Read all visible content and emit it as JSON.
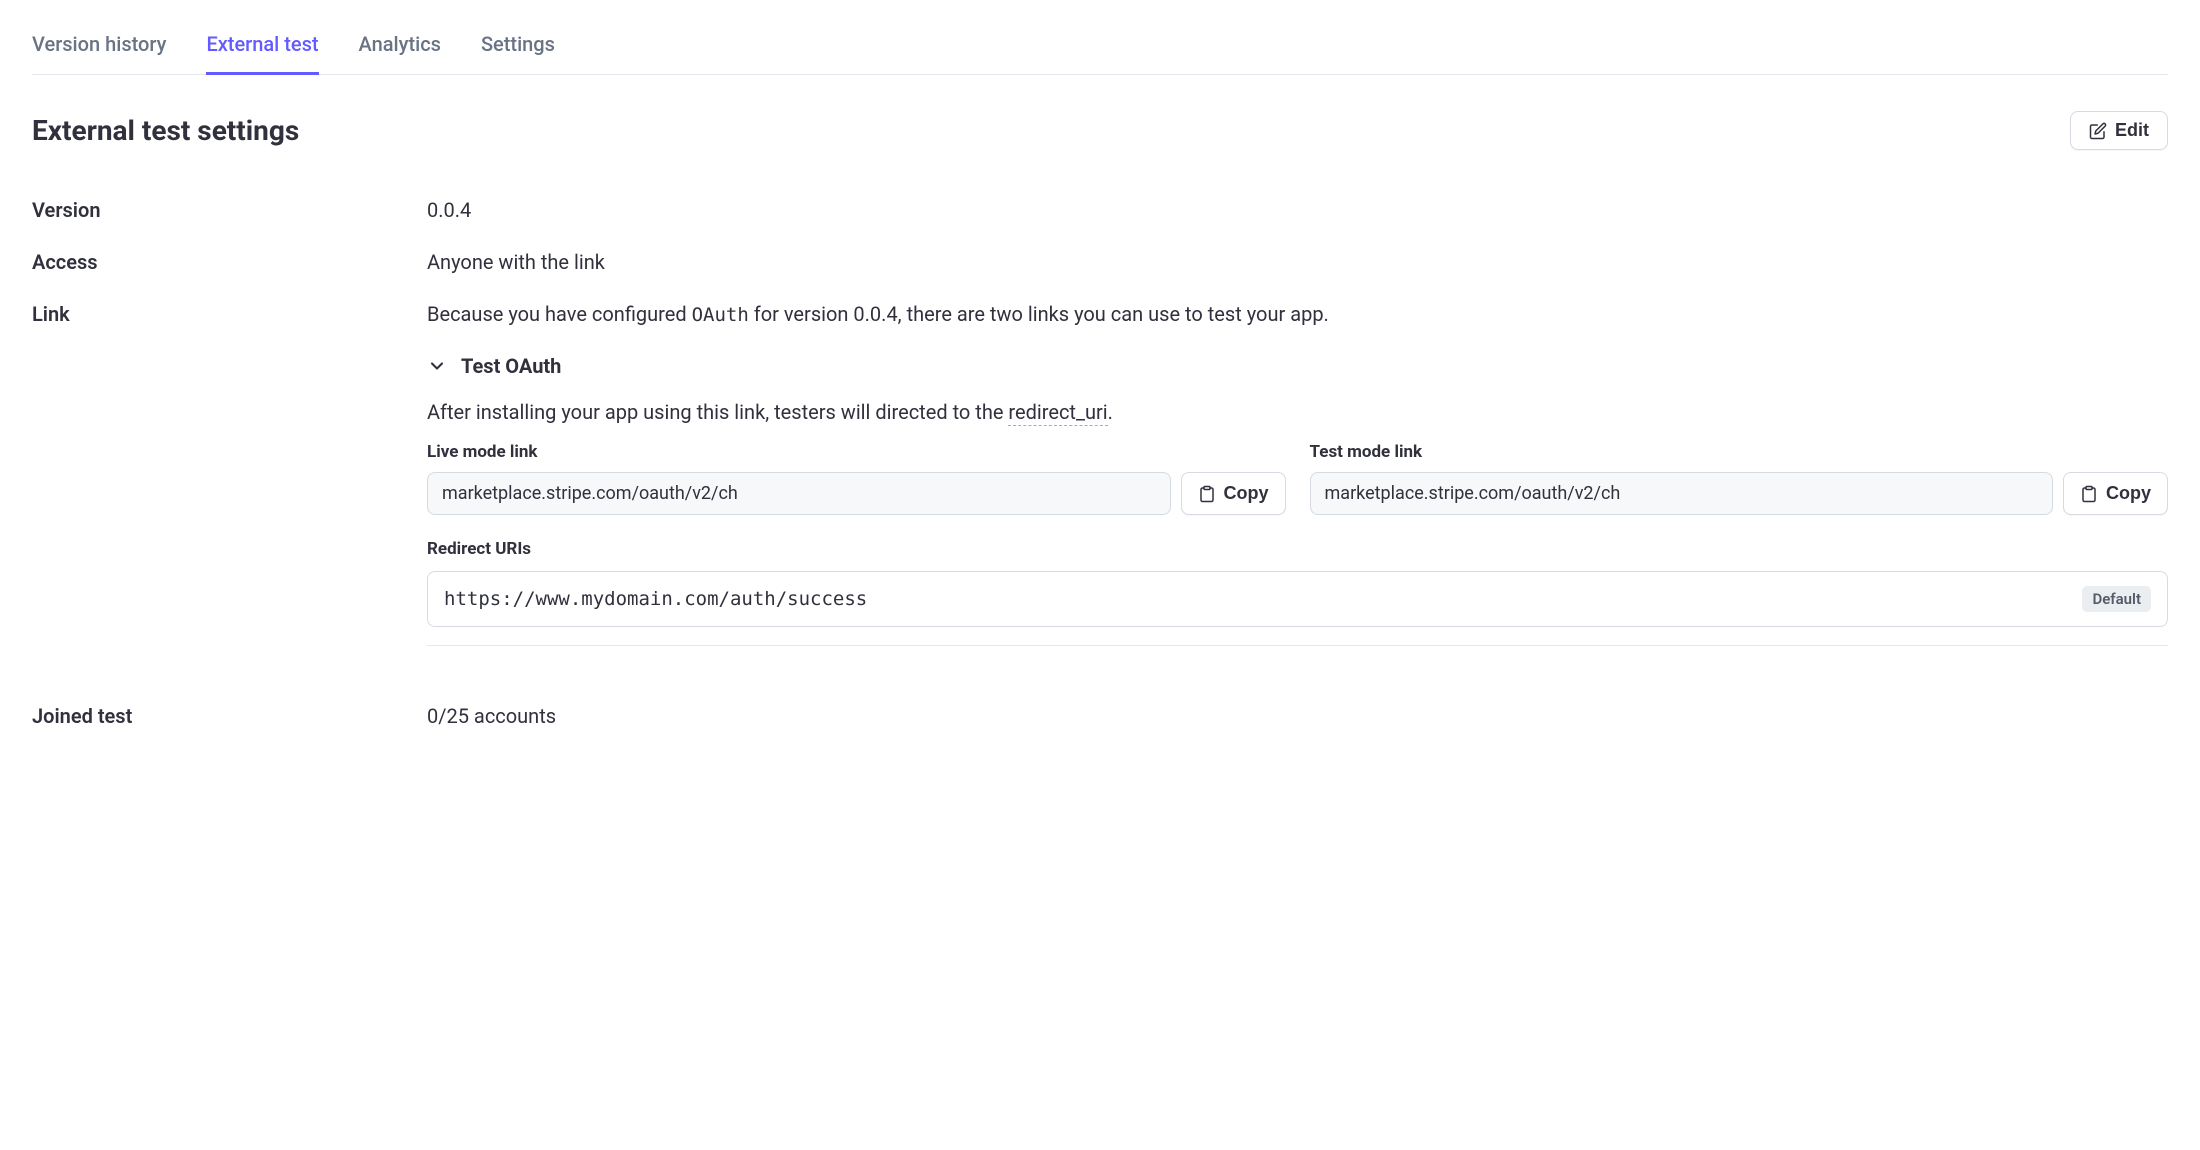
{
  "tabs": [
    {
      "label": "Version history",
      "active": false
    },
    {
      "label": "External test",
      "active": true
    },
    {
      "label": "Analytics",
      "active": false
    },
    {
      "label": "Settings",
      "active": false
    }
  ],
  "header": {
    "title": "External test settings",
    "edit_label": "Edit"
  },
  "version": {
    "label": "Version",
    "value": "0.0.4"
  },
  "access": {
    "label": "Access",
    "value": "Anyone with the link"
  },
  "link": {
    "label": "Link",
    "desc_prefix": "Because you have configured ",
    "desc_oauth": "OAuth",
    "desc_mid": " for version 0.0.4, there are two links you can use to test your app.",
    "oauth_section_title": "Test OAuth",
    "oauth_desc_prefix": "After installing your app using this link, testers will directed to the ",
    "oauth_desc_link": "redirect_uri",
    "oauth_desc_suffix": ".",
    "live_mode_label": "Live mode link",
    "live_mode_url": "marketplace.stripe.com/oauth/v2/ch",
    "test_mode_label": "Test mode link",
    "test_mode_url": "marketplace.stripe.com/oauth/v2/ch",
    "copy_label": "Copy",
    "redirect_uris_label": "Redirect URIs",
    "redirect_uri_value": "https://www.mydomain.com/auth/success",
    "default_badge": "Default"
  },
  "joined": {
    "label": "Joined test",
    "value": "0/25 accounts"
  }
}
